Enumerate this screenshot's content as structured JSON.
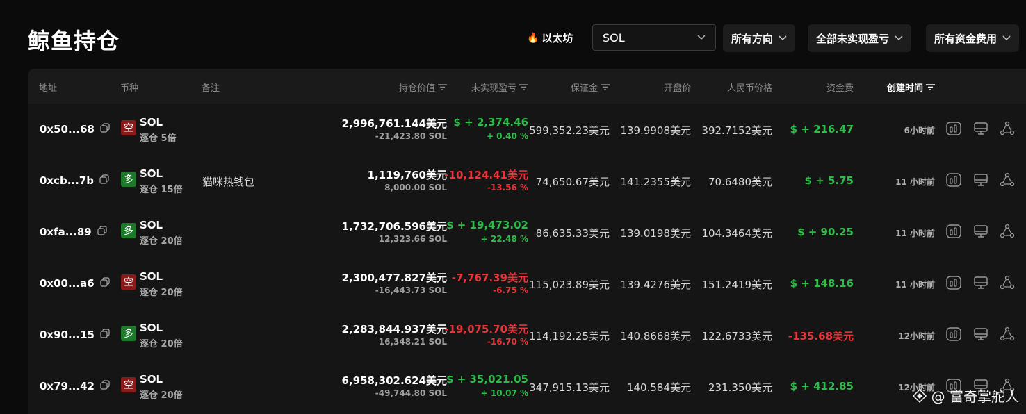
{
  "page": {
    "title": "鲸鱼持仓"
  },
  "toolbar": {
    "chain_label": "以太坊",
    "coin_select": "SOL",
    "direction": "所有方向",
    "pnl_filter": "全部未实现盈亏",
    "funding_filter": "所有资金费用"
  },
  "columns": {
    "address": "地址",
    "coin": "币种",
    "note": "备注",
    "position_value": "持仓价值",
    "unrealized_pnl": "未实现盈亏",
    "margin": "保证金",
    "open_price": "开盘价",
    "rmb_price": "人民币价格",
    "funding": "资金费",
    "created": "创建时间"
  },
  "rows": [
    {
      "address": "0x50...68",
      "side": "空",
      "side_type": "short",
      "coin": "SOL",
      "leverage": "逐仓 5倍",
      "note": "",
      "position_value": "2,996,761.144美元",
      "position_qty": "-21,423.80 SOL",
      "pnl": "$ + 2,374.46",
      "pnl_pct": "+ 0.40 %",
      "pnl_sign": "green",
      "margin": "599,352.23美元",
      "open_price": "139.9908美元",
      "rmb_price": "392.7152美元",
      "funding": "$ + 216.47",
      "funding_sign": "green",
      "created": "6小时前"
    },
    {
      "address": "0xcb...7b",
      "side": "多",
      "side_type": "long",
      "coin": "SOL",
      "leverage": "逐仓 15倍",
      "note": "猫咪热钱包",
      "position_value": "1,119,760美元",
      "position_qty": "8,000.00 SOL",
      "pnl": "-10,124.41美元",
      "pnl_pct": "-13.56 %",
      "pnl_sign": "red",
      "margin": "74,650.67美元",
      "open_price": "141.2355美元",
      "rmb_price": "70.6480美元",
      "funding": "$ + 5.75",
      "funding_sign": "green",
      "created": "11 小时前"
    },
    {
      "address": "0xfa...89",
      "side": "多",
      "side_type": "long",
      "coin": "SOL",
      "leverage": "逐仓 20倍",
      "note": "",
      "position_value": "1,732,706.596美元",
      "position_qty": "12,323.66 SOL",
      "pnl": "$ + 19,473.02",
      "pnl_pct": "+ 22.48 %",
      "pnl_sign": "green",
      "margin": "86,635.33美元",
      "open_price": "139.0198美元",
      "rmb_price": "104.3464美元",
      "funding": "$ + 90.25",
      "funding_sign": "green",
      "created": "11 小时前"
    },
    {
      "address": "0x00...a6",
      "side": "空",
      "side_type": "short",
      "coin": "SOL",
      "leverage": "逐仓 20倍",
      "note": "",
      "position_value": "2,300,477.827美元",
      "position_qty": "-16,443.73 SOL",
      "pnl": "-7,767.39美元",
      "pnl_pct": "-6.75 %",
      "pnl_sign": "red",
      "margin": "115,023.89美元",
      "open_price": "139.4276美元",
      "rmb_price": "151.2419美元",
      "funding": "$ + 148.16",
      "funding_sign": "green",
      "created": "11 小时前"
    },
    {
      "address": "0x90...15",
      "side": "多",
      "side_type": "long",
      "coin": "SOL",
      "leverage": "逐仓 20倍",
      "note": "",
      "position_value": "2,283,844.937美元",
      "position_qty": "16,348.21 SOL",
      "pnl": "-19,075.70美元",
      "pnl_pct": "-16.70 %",
      "pnl_sign": "red",
      "margin": "114,192.25美元",
      "open_price": "140.8668美元",
      "rmb_price": "122.6733美元",
      "funding": "-135.68美元",
      "funding_sign": "red",
      "created": "12小时前"
    },
    {
      "address": "0x79...42",
      "side": "空",
      "side_type": "short",
      "coin": "SOL",
      "leverage": "逐仓 20倍",
      "note": "",
      "position_value": "6,958,302.624美元",
      "position_qty": "-49,744.80 SOL",
      "pnl": "$ + 35,021.05",
      "pnl_pct": "+ 10.07 %",
      "pnl_sign": "green",
      "margin": "347,915.13美元",
      "open_price": "140.584美元",
      "rmb_price": "231.350美元",
      "funding": "$ + 412.85",
      "funding_sign": "green",
      "created": "12小时前"
    }
  ],
  "watermark": "@ 富奇掌舵人",
  "colors": {
    "green": "#2ebd4a",
    "red": "#e8343a",
    "short_badge": "#8b1a1a",
    "long_badge": "#1c7a2a"
  }
}
